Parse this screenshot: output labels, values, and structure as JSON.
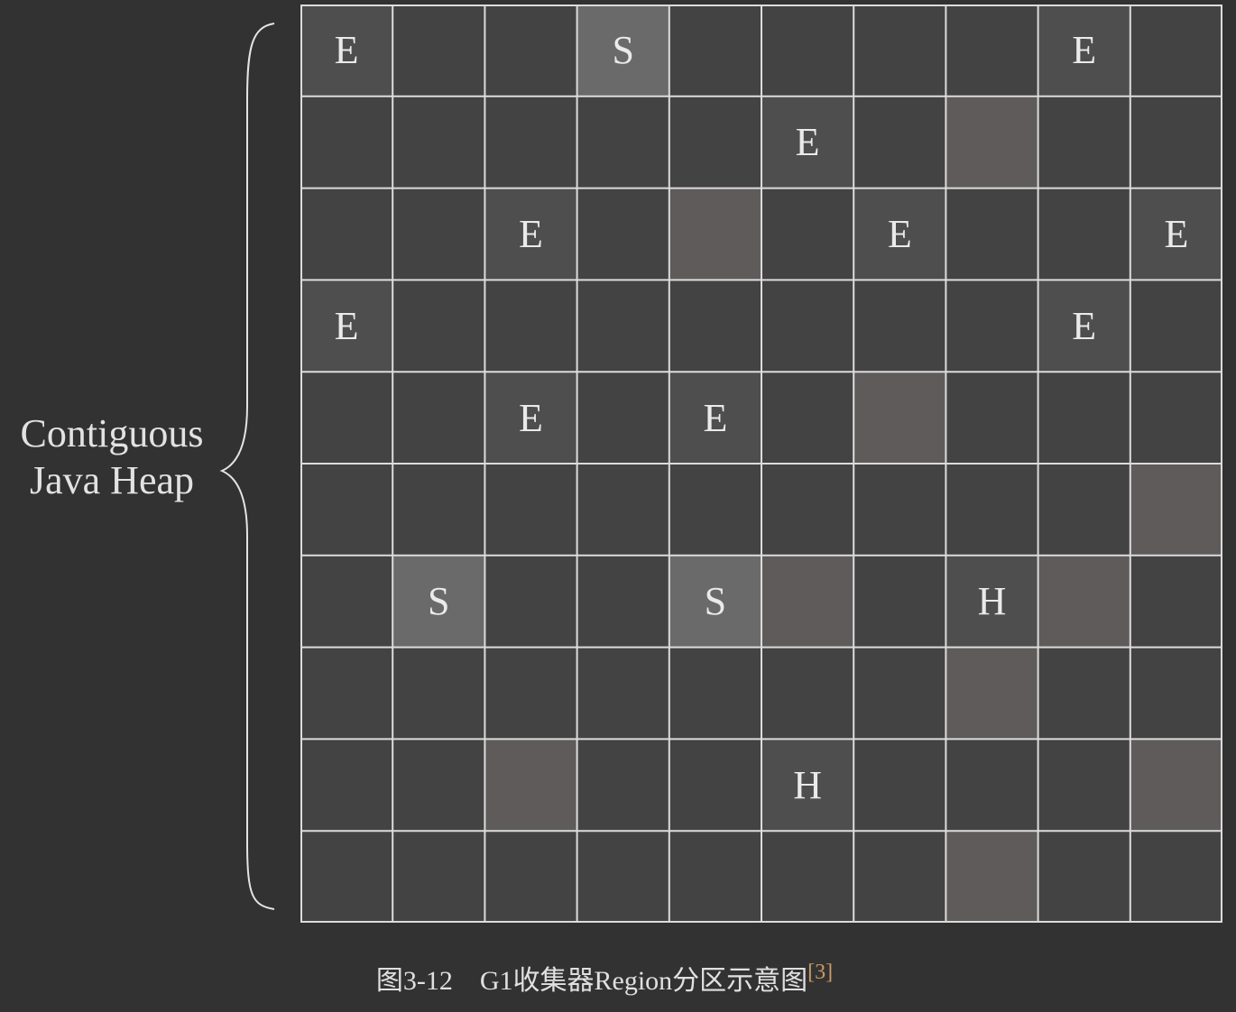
{
  "heap_label": {
    "line1": "Contiguous",
    "line2": "Java Heap"
  },
  "grid": {
    "rows": [
      [
        "E",
        "",
        "",
        "S",
        "",
        "",
        "",
        "",
        "E",
        ""
      ],
      [
        "",
        "",
        "",
        "",
        "",
        "E",
        "",
        "#",
        "",
        ""
      ],
      [
        "",
        "",
        "E",
        "",
        "#",
        "",
        "E",
        "",
        "",
        "E"
      ],
      [
        "E",
        "",
        "",
        "",
        "",
        "",
        "",
        "",
        "E",
        ""
      ],
      [
        "",
        "",
        "E",
        "",
        "E",
        "",
        "#",
        "",
        "",
        ""
      ],
      [
        "",
        "",
        "",
        "",
        "",
        "",
        "",
        "",
        "",
        "#"
      ],
      [
        "",
        "S",
        "",
        "",
        "S",
        "#",
        "",
        "H",
        "#",
        ""
      ],
      [
        "",
        "",
        "",
        "",
        "",
        "",
        "",
        "#",
        "",
        ""
      ],
      [
        "",
        "",
        "#",
        "",
        "",
        "H",
        "",
        "",
        "",
        "#"
      ],
      [
        "",
        "",
        "",
        "",
        "",
        "",
        "",
        "#",
        "",
        ""
      ]
    ],
    "legend": {
      "#": "occupied-unlabeled"
    }
  },
  "colors": {
    "background": "#323232",
    "free": "#434343",
    "eden": "#4e4e4e",
    "survivor": "#6a6a6a",
    "humongous": "#4e4e4e",
    "occupied": "#5e5b5a",
    "grid_line": "#dcdcdc",
    "text": "#eaeaea"
  },
  "caption": {
    "text": "图3-12　G1收集器Region分区示意图",
    "ref": "[3]"
  }
}
